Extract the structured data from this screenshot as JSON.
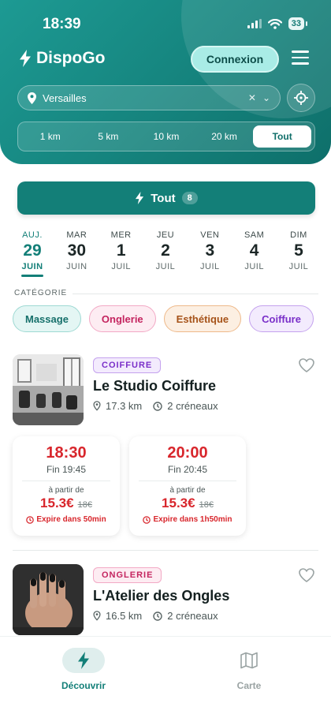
{
  "status_bar": {
    "time": "18:39",
    "battery": "33"
  },
  "app": {
    "name": "DispoGo",
    "login_label": "Connexion"
  },
  "search": {
    "location": "Versailles"
  },
  "radius_options": [
    "1 km",
    "5 km",
    "10 km",
    "20 km",
    "Tout"
  ],
  "radius_selected": "Tout",
  "filter_button": {
    "label": "Tout",
    "count": "8"
  },
  "dates": [
    {
      "dow": "AUJ.",
      "day": "29",
      "month": "JUIN",
      "active": true
    },
    {
      "dow": "MAR",
      "day": "30",
      "month": "JUIN"
    },
    {
      "dow": "MER",
      "day": "1",
      "month": "JUIL"
    },
    {
      "dow": "JEU",
      "day": "2",
      "month": "JUIL"
    },
    {
      "dow": "VEN",
      "day": "3",
      "month": "JUIL"
    },
    {
      "dow": "SAM",
      "day": "4",
      "month": "JUIL"
    },
    {
      "dow": "DIM",
      "day": "5",
      "month": "JUIL"
    }
  ],
  "categories_label": "CATÉGORIE",
  "categories": [
    "Massage",
    "Onglerie",
    "Esthétique",
    "Coiffure"
  ],
  "listings": [
    {
      "tag": "COIFFURE",
      "name": "Le Studio Coiffure",
      "distance": "17.3 km",
      "slots_count": "2 créneaux",
      "slots": [
        {
          "time": "18:30",
          "end": "Fin 19:45",
          "from": "à partir de",
          "price": "15.3€",
          "old_price": "18€",
          "expires": "Expire dans 50min"
        },
        {
          "time": "20:00",
          "end": "Fin 20:45",
          "from": "à partir de",
          "price": "15.3€",
          "old_price": "18€",
          "expires": "Expire dans 1h50min"
        }
      ]
    },
    {
      "tag": "ONGLERIE",
      "name": "L'Atelier des Ongles",
      "distance": "16.5 km",
      "slots_count": "2 créneaux"
    }
  ],
  "nav": {
    "discover": "Découvrir",
    "map": "Carte"
  },
  "colors": {
    "primary": "#137f78",
    "accent_red": "#d8262c",
    "header": "#1d9a93"
  }
}
